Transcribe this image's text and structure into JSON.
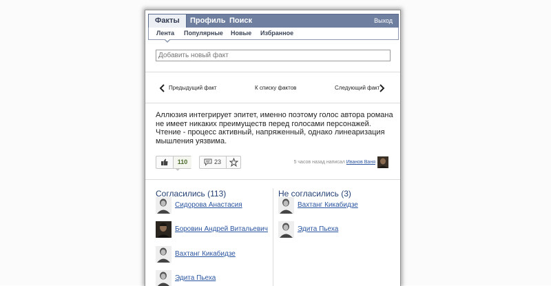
{
  "topnav": {
    "tabs": [
      {
        "label": "Факты",
        "active": true
      },
      {
        "label": "Профиль",
        "active": false
      },
      {
        "label": "Поиск",
        "active": false
      }
    ],
    "logout": "Выход"
  },
  "subnav": {
    "items": [
      "Лента",
      "Популярные",
      "Новые",
      "Избранное"
    ],
    "active_index": 0
  },
  "add_fact": {
    "placeholder": "Добавить новый факт"
  },
  "fact_nav": {
    "prev": "Предыдущий факт",
    "list": "К списку фактов",
    "next": "Следующий факт"
  },
  "fact": {
    "text": "Аллюзия интегрирует эпитет, именно поэтому голос автора романа не имеет никаких преимуществ перед голосами персонажей. Чтение - процесс активный, напряженный, однако линеаризация мышления уязвима.",
    "likes": "110",
    "comments": "23",
    "meta_prefix": "5 часов назад написал",
    "author": "Иванов Ваня"
  },
  "agree": {
    "title": "Согласились (113)",
    "people": [
      "Сидорова Анастасия",
      "Боровин Андрей Витальевич",
      "Вахтанг Кикабидзе",
      "Эдита Пьеха"
    ]
  },
  "disagree": {
    "title": "Не согласились (3)",
    "people": [
      "Вахтанг Кикабидзе",
      "Эдита Пьеха"
    ]
  },
  "icons": {
    "prev": "chevron-left-icon",
    "next": "chevron-right-icon",
    "like": "thumbs-up-icon",
    "comment": "speech-bubble-icon",
    "favorite": "star-icon"
  },
  "colors": {
    "nav_bg": "#6e7fa0",
    "link": "#2a55a0",
    "column_title": "#233f73",
    "likes": "#4b6a2b"
  }
}
